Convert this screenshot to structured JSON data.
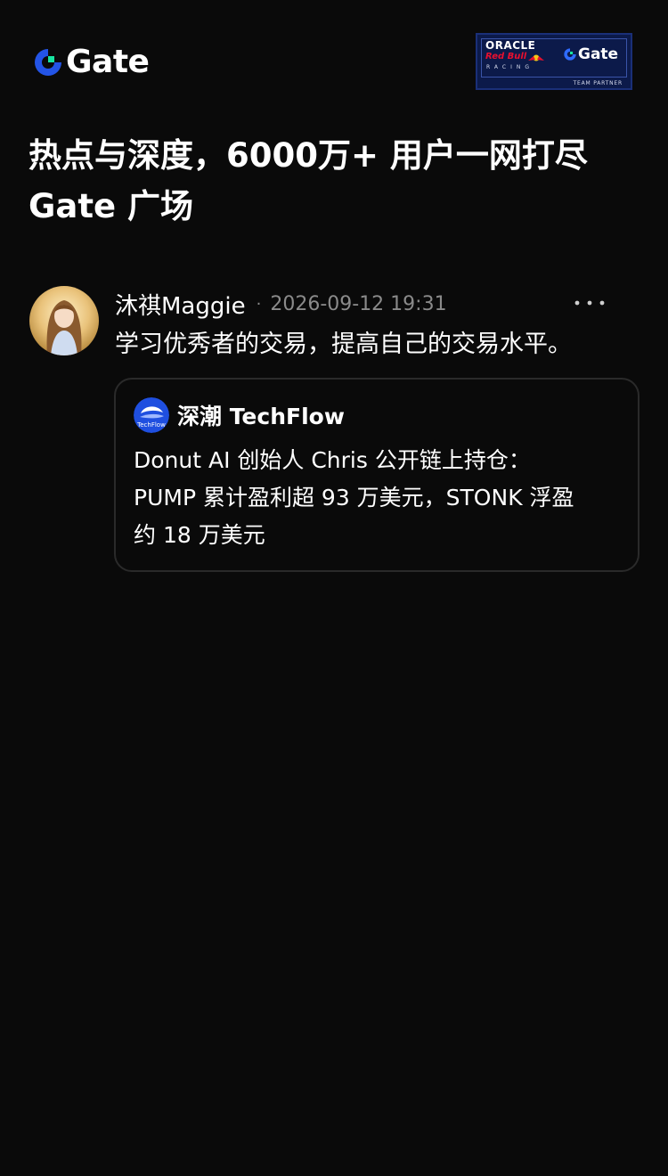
{
  "header": {
    "logo_text": "Gate",
    "partner_badge": {
      "oracle": "ORACLE",
      "redbull": "Red Bull",
      "racing": "RACING",
      "gate": "Gate",
      "team_partner": "TEAM PARTNER"
    }
  },
  "headline": {
    "line1": "热点与深度，6000万+ 用户一网打尽",
    "line2": "Gate 广场"
  },
  "post": {
    "author": "沐祺Maggie",
    "separator": "·",
    "timestamp": "2026-09-12 19:31",
    "text": "学习优秀者的交易，提高自己的交易水平。",
    "quote": {
      "source_name": "深潮 TechFlow",
      "source_icon_text": "TechFlow",
      "lines": [
        "Donut AI 创始人 Chris 公开链上持仓：",
        "PUMP 累计盈利超 93 万美元，STONK 浮盈",
        "约 18 万美元"
      ]
    }
  },
  "colors": {
    "background": "#0a0a0a",
    "brand_blue": "#2354e6",
    "brand_green": "#17e5a1",
    "muted_text": "#8a8a8a",
    "card_border": "#2a2a2a"
  },
  "icons": {
    "logo": "gate-logo-icon",
    "more": "more-dots-icon",
    "avatar": "user-avatar",
    "source": "techflow-source-icon"
  }
}
